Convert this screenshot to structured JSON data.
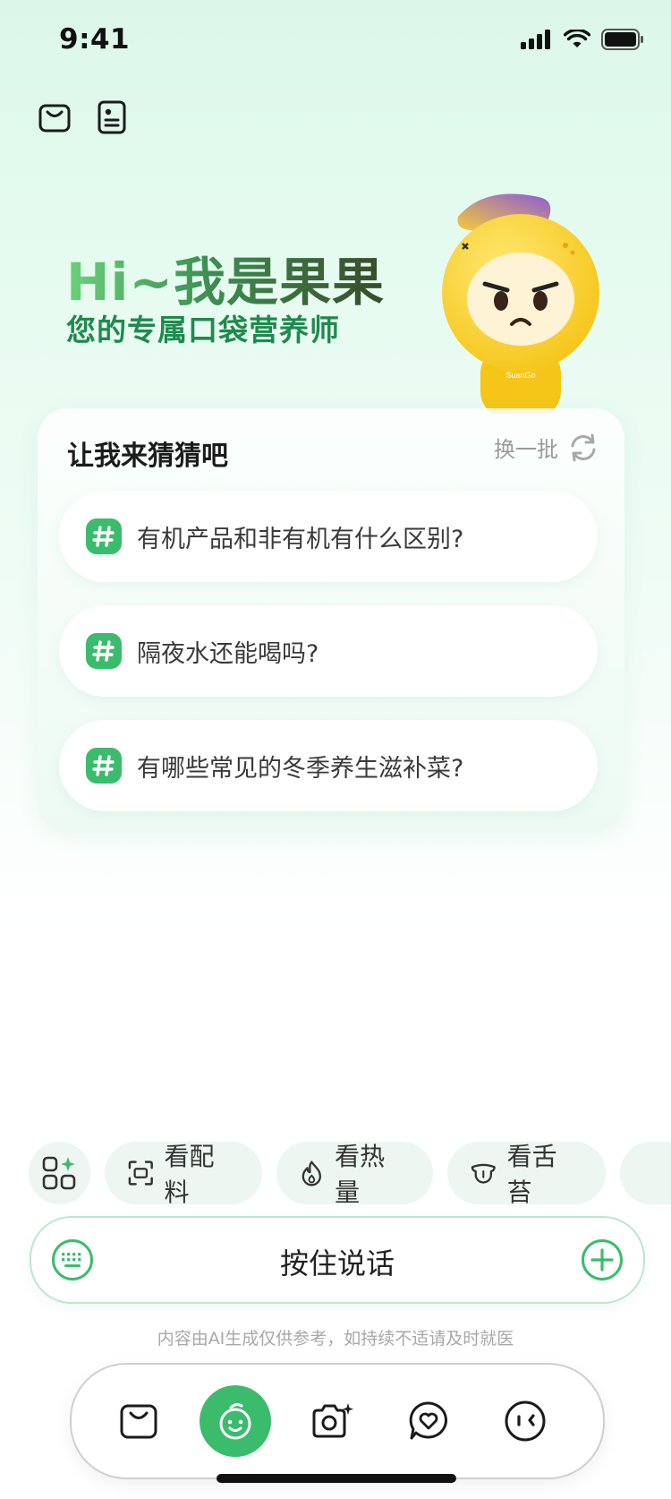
{
  "status_bar": {
    "time": "9:41"
  },
  "hero": {
    "title": "Hi~我是果果",
    "subtitle": "您的专属口袋营养师"
  },
  "guess": {
    "title": "让我来猜猜吧",
    "refresh_label": "换一批",
    "questions": [
      "有机产品和非有机有什么区别?",
      "隔夜水还能喝吗?",
      "有哪些常见的冬季养生滋补菜?"
    ]
  },
  "chips": [
    "看配料",
    "看热量",
    "看舌苔"
  ],
  "voice": {
    "label": "按住说话"
  },
  "disclaimer": "内容由AI生成仅供参考，如持续不适请及时就医",
  "colors": {
    "accent": "#3bbc6c",
    "subtitle": "#1f8a4e"
  },
  "icons": {
    "top": [
      "shopping-bag-icon",
      "health-profile-icon"
    ],
    "tabbar": [
      "shopping-bag-icon",
      "mascot-face-icon",
      "camera-sparkle-icon",
      "heart-chat-icon",
      "face-icon"
    ]
  }
}
